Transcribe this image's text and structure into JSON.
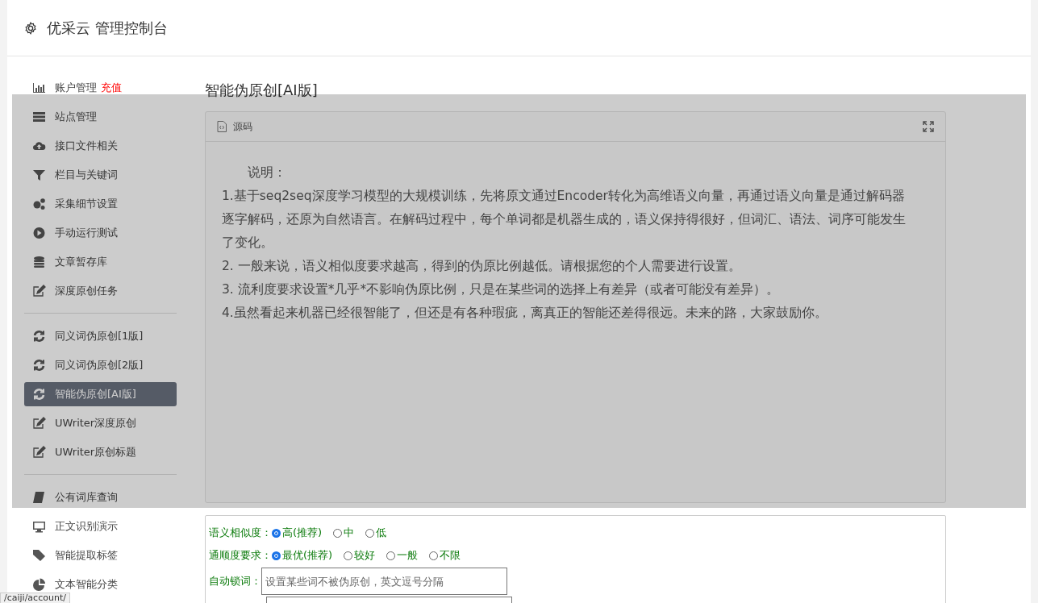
{
  "header": {
    "title": "优采云 管理控制台"
  },
  "sidebar": {
    "groups": [
      [
        {
          "label": "账户管理",
          "badge": "充值",
          "selected": false
        },
        {
          "label": "站点管理",
          "selected": false
        },
        {
          "label": "接口文件相关",
          "selected": false
        },
        {
          "label": "栏目与关键词",
          "selected": false
        },
        {
          "label": "采集细节设置",
          "selected": false
        },
        {
          "label": "手动运行测试",
          "selected": false
        },
        {
          "label": "文章暂存库",
          "selected": false
        },
        {
          "label": "深度原创任务",
          "selected": false
        }
      ],
      [
        {
          "label": "同义词伪原创[1版]",
          "selected": false
        },
        {
          "label": "同义词伪原创[2版]",
          "selected": false
        },
        {
          "label": "智能伪原创[AI版]",
          "selected": true
        },
        {
          "label": "UWriter深度原创",
          "selected": false
        },
        {
          "label": "UWriter原创标题",
          "selected": false
        }
      ],
      [
        {
          "label": "公有词库查询",
          "selected": false
        },
        {
          "label": "正文识别演示",
          "selected": false
        },
        {
          "label": "智能提取标签",
          "selected": false
        },
        {
          "label": "文本智能分类",
          "selected": false
        }
      ]
    ]
  },
  "content": {
    "title": "智能伪原创[AI版]",
    "panel": {
      "title": "源码",
      "heading": "说明：",
      "paragraphs": [
        "1.基于seq2seq深度学习模型的大规模训练，先将原文通过Encoder转化为高维语义向量，再通过语义向量是通过解码器逐字解码，还原为自然语言。在解码过程中，每个单词都是机器生成的，语义保持得很好，但词汇、语法、词序可能发生了变化。",
        "2. 一般来说，语义相似度要求越高，得到的伪原比例越低。请根据您的个人需要进行设置。",
        "3. 流利度要求设置*几乎*不影响伪原比例，只是在某些词的选择上有差异（或者可能没有差异）。",
        "4.虽然看起来机器已经很智能了，但还是有各种瑕疵，离真正的智能还差得很远。未来的路，大家鼓励你。"
      ]
    },
    "form": {
      "radio_rows": [
        {
          "label": "语义相似度：",
          "options": [
            {
              "label": "高(推荐)",
              "selected": true
            },
            {
              "label": "中",
              "selected": false
            },
            {
              "label": "低",
              "selected": false
            }
          ]
        },
        {
          "label": "通顺度要求：",
          "options": [
            {
              "label": "最优(推荐)",
              "selected": true
            },
            {
              "label": "较好",
              "selected": false
            },
            {
              "label": "一般",
              "selected": false
            },
            {
              "label": "不限",
              "selected": false
            }
          ]
        }
      ],
      "lock_words": {
        "label": "自动锁词：",
        "placeholder": "设置某些词不被伪原创，英文逗号分隔"
      }
    }
  },
  "status_bar": {
    "url": "/caiji/account/"
  }
}
